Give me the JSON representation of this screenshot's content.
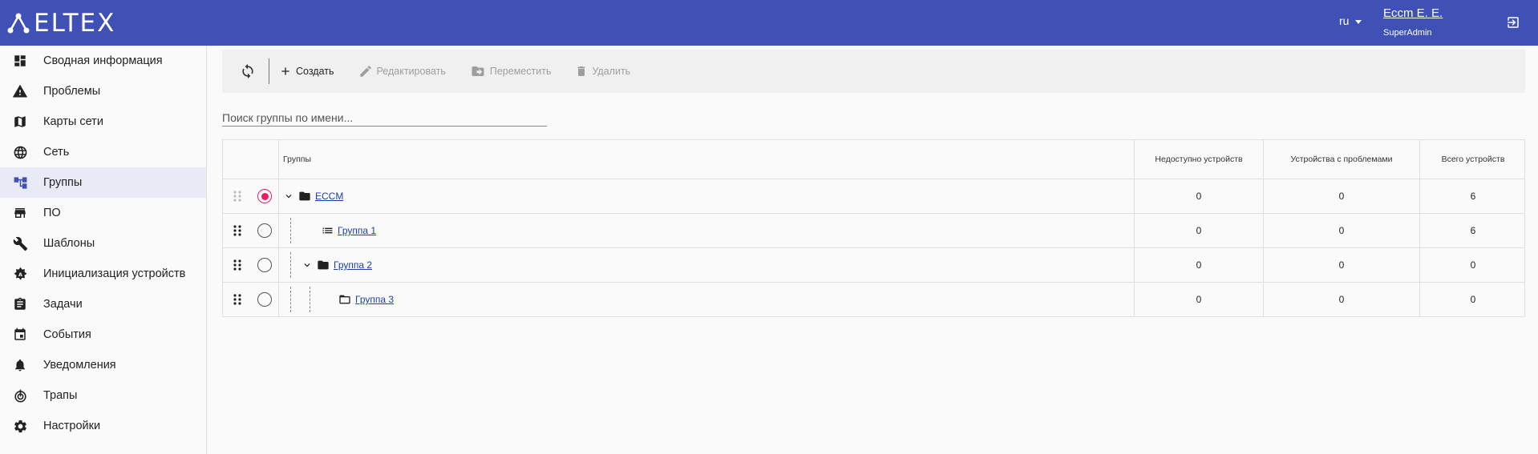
{
  "header": {
    "logo_text": "ELTEX",
    "language": "ru",
    "user_name": "Eccm E. E.",
    "user_role": "SuperAdmin",
    "bg_color": "#3f51b5"
  },
  "sidebar": {
    "items": [
      {
        "label": "Сводная информация",
        "icon": "dashboard-icon"
      },
      {
        "label": "Проблемы",
        "icon": "warning-icon"
      },
      {
        "label": "Карты сети",
        "icon": "map-icon"
      },
      {
        "label": "Сеть",
        "icon": "globe-icon"
      },
      {
        "label": "Группы",
        "icon": "tree-icon",
        "active": true
      },
      {
        "label": "ПО",
        "icon": "store-icon"
      },
      {
        "label": "Шаблоны",
        "icon": "wrench-icon"
      },
      {
        "label": "Инициализация устройств",
        "icon": "init-icon"
      },
      {
        "label": "Задачи",
        "icon": "clipboard-icon"
      },
      {
        "label": "События",
        "icon": "calendar-icon"
      },
      {
        "label": "Уведомления",
        "icon": "bell-icon"
      },
      {
        "label": "Трапы",
        "icon": "trap-icon"
      },
      {
        "label": "Настройки",
        "icon": "gear-icon"
      }
    ]
  },
  "toolbar": {
    "create_label": "Создать",
    "edit_label": "Редактировать",
    "move_label": "Переместить",
    "delete_label": "Удалить"
  },
  "search": {
    "placeholder": "Поиск группы по имени..."
  },
  "table": {
    "columns": {
      "groups": "Группы",
      "unavailable": "Недоступно устройств",
      "problems": "Устройства с проблемами",
      "total": "Всего устройств"
    },
    "rows": [
      {
        "name": "ECCM",
        "unavailable": "0",
        "problems": "0",
        "total": "6",
        "selected": true,
        "level": 0,
        "icon": "folder-icon",
        "expanded": true
      },
      {
        "name": "Группа 1",
        "unavailable": "0",
        "problems": "0",
        "total": "6",
        "selected": false,
        "level": 1,
        "icon": "list-icon"
      },
      {
        "name": "Группа 2",
        "unavailable": "0",
        "problems": "0",
        "total": "0",
        "selected": false,
        "level": 1,
        "icon": "folder-icon",
        "expanded": true
      },
      {
        "name": "Группа 3",
        "unavailable": "0",
        "problems": "0",
        "total": "0",
        "selected": false,
        "level": 2,
        "icon": "folder-open-icon"
      }
    ]
  },
  "colors": {
    "accent": "#3f51b5",
    "selection": "#e91e63",
    "link": "#1a3fa8"
  }
}
